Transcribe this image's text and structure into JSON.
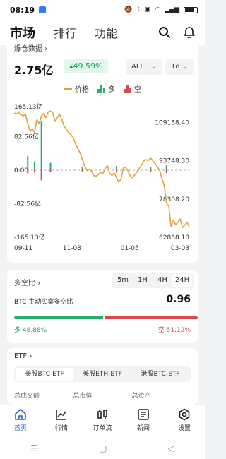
{
  "status_bar": {
    "time": "08:19",
    "battery": ""
  },
  "header": {
    "tabs": [
      "市场",
      "排行",
      "功能"
    ]
  },
  "liquidation": {
    "title": "爆仓数据",
    "value": "2.75亿",
    "change": "49.59%",
    "range_select": "ALL",
    "interval_select": "1d",
    "legend": {
      "price": "价格",
      "long": "多",
      "short": "空"
    }
  },
  "chart_data": {
    "type": "line",
    "title": "",
    "x_ticks": [
      "09-11",
      "11-08",
      "01-05",
      "03-03"
    ],
    "y_left_ticks": [
      "165.13亿",
      "82.56亿",
      "0.00",
      "-82.56亿",
      "-165.13亿"
    ],
    "y_left_range": [
      -165.13,
      165.13
    ],
    "y_right_ticks": [
      "109188.40",
      "93748.30",
      "78308.20",
      "62868.10"
    ],
    "y_right_range": [
      62868.1,
      117000
    ],
    "colors": {
      "price": "#e3a33b",
      "long": "#2aae70",
      "short": "#d9484d"
    },
    "series": [
      {
        "name": "价格",
        "axis": "right",
        "values": [
          113000,
          112600,
          113200,
          112400,
          111800,
          112500,
          108600,
          105800,
          106600,
          105200,
          110400,
          108700,
          111800,
          112800,
          111200,
          113400,
          113800,
          113000,
          109600,
          111200,
          112600,
          110200,
          107600,
          106400,
          105000,
          104200,
          103000,
          100600,
          98700,
          96800,
          94200,
          91800,
          89800,
          90300,
          89500,
          87800,
          87400,
          88200,
          89100,
          88600,
          90400,
          91800,
          88700,
          87800,
          88900,
          87000,
          85100,
          86300,
          90800,
          91200,
          89800,
          87700,
          86900,
          88000,
          89200,
          90600,
          92100,
          93600,
          94200,
          93800,
          94800,
          93700,
          92600,
          91200,
          89900,
          86400,
          83700,
          76600,
          75400,
          67200,
          69700,
          68000,
          68900,
          70300,
          66800,
          67800,
          68900,
          67100
        ]
      },
      {
        "name": "多",
        "axis": "left",
        "values": [
          0,
          0,
          0,
          0,
          0,
          0,
          0,
          0,
          0,
          0,
          0,
          0,
          0,
          0,
          0,
          0,
          0,
          0,
          0,
          0,
          0,
          0,
          0,
          0,
          0,
          0,
          0,
          0,
          0,
          0,
          0,
          0,
          0,
          0,
          0,
          0,
          0,
          0,
          0,
          0,
          0,
          0,
          0,
          0,
          0,
          0,
          0,
          0,
          0,
          0,
          0,
          0,
          0,
          0,
          0,
          0,
          0,
          0,
          0,
          0,
          0,
          0,
          0,
          0,
          0,
          0,
          0,
          0,
          0,
          0,
          0,
          0,
          0,
          0,
          0,
          0,
          0,
          0
        ]
      },
      {
        "name": "空",
        "axis": "left",
        "values": [
          0,
          0,
          0,
          0,
          0,
          0,
          0,
          0,
          0,
          0,
          0,
          0,
          0,
          0,
          0,
          0,
          0,
          0,
          0,
          0,
          0,
          0,
          0,
          0,
          0,
          0,
          0,
          0,
          0,
          0,
          0,
          0,
          0,
          0,
          0,
          0,
          0,
          0,
          0,
          0,
          0,
          0,
          0,
          0,
          0,
          0,
          0,
          0,
          0,
          0,
          0,
          0,
          0,
          0,
          0,
          0,
          0,
          0,
          0,
          0,
          0,
          0,
          0,
          0,
          0,
          0,
          0,
          0,
          0,
          0,
          0,
          0,
          0,
          0,
          0,
          0,
          0,
          0
        ]
      }
    ],
    "bar_highlights": [
      {
        "index": 12,
        "long": 120,
        "short": -25
      },
      {
        "index": 6,
        "long": 35,
        "short": -8
      },
      {
        "index": 9,
        "long": 22,
        "short": -6
      },
      {
        "index": 16,
        "long": 18,
        "short": -5
      },
      {
        "index": 30,
        "long": 8,
        "short": -4
      },
      {
        "index": 45,
        "long": 10,
        "short": -6
      },
      {
        "index": 60,
        "long": 7,
        "short": -5
      },
      {
        "index": 67,
        "long": 12,
        "short": -7
      }
    ],
    "grid": false
  },
  "long_short": {
    "title": "多空比",
    "periods": [
      "5m",
      "1H",
      "4H",
      "24H"
    ],
    "selected_period": "24H",
    "subtitle": "BTC 主动买卖多空比",
    "ratio": "0.96",
    "long_label": "多 48.88%",
    "short_label": "空 51.12%",
    "long_pct": 48.88,
    "short_pct": 51.12
  },
  "etf": {
    "title": "ETF",
    "tabs": [
      "美股BTC-ETF",
      "美股ETH-ETF",
      "港股BTC-ETF"
    ],
    "columns": [
      "总成交额",
      "总市值",
      "总资产"
    ]
  },
  "bottom_nav": [
    "首页",
    "行情",
    "订单流",
    "新闻",
    "设置"
  ]
}
